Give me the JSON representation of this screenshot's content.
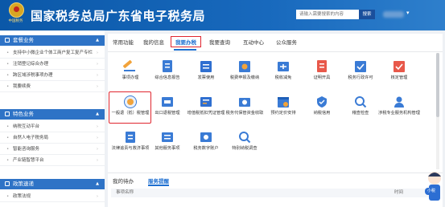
{
  "header": {
    "emblem_caption": "中国税务",
    "site_title": "国家税务总局广东省电子税务局",
    "search_placeholder": "请输入需要搜索的内容",
    "search_button": "搜索"
  },
  "sidebar": {
    "sections": [
      {
        "title": "套餐业务",
        "items": [
          "支持中小微企业个体工商户复工复产专栏",
          "注销登记综合办理",
          "跨区域涉税事项办理",
          "我要续费"
        ]
      },
      {
        "title": "特色业务",
        "items": [
          "纳税互动平台",
          "自然人电子税务局",
          "智能咨询服务",
          "产业链智慧平台"
        ]
      },
      {
        "title": "政策速递",
        "items": [
          "政策法规"
        ]
      }
    ]
  },
  "main": {
    "tabs": [
      "常用功能",
      "我的信息",
      "我要办税",
      "我要查询",
      "互动中心",
      "公众服务"
    ],
    "active_tab": "我要办税",
    "tiles": [
      {
        "label": "事项办理",
        "icon": "pen-icon"
      },
      {
        "label": "综合信息报告",
        "icon": "info-report-icon"
      },
      {
        "label": "发票使用",
        "icon": "invoice-icon"
      },
      {
        "label": "税费申报及缴纳",
        "icon": "tax-declare-icon"
      },
      {
        "label": "税收减免",
        "icon": "tax-relief-icon"
      },
      {
        "label": "证明开具",
        "icon": "certificate-icon"
      },
      {
        "label": "税务行政许可",
        "icon": "license-icon"
      },
      {
        "label": "核定管理",
        "icon": "verify-icon"
      },
      {
        "label": "一般退（抵）税管理",
        "icon": "refund-icon"
      },
      {
        "label": "出口退税管理",
        "icon": "export-refund-icon"
      },
      {
        "label": "增值税抵扣凭证管理",
        "icon": "vat-deduction-icon"
      },
      {
        "label": "税务代保管资金收取",
        "icon": "fund-custody-icon"
      },
      {
        "label": "预约定价安排",
        "icon": "calendar-icon"
      },
      {
        "label": "纳税信用",
        "icon": "credit-icon"
      },
      {
        "label": "稽查检查",
        "icon": "inspection-icon"
      },
      {
        "label": "涉税专业服务机构管理",
        "icon": "agency-icon"
      },
      {
        "label": "法律追责与救济事项",
        "icon": "law-icon"
      },
      {
        "label": "其他服务事项",
        "icon": "other-services-icon"
      },
      {
        "label": "税务数字账户",
        "icon": "digital-account-icon"
      },
      {
        "label": "特别纳税调查",
        "icon": "special-tax-icon"
      }
    ],
    "bottom_tabs": [
      "我的待办",
      "服务提醒"
    ],
    "table_headers": [
      "事项名称",
      "时间"
    ]
  },
  "mascot": {
    "bubble_text": "小税"
  },
  "colors": {
    "header_blue": "#0b58a8",
    "sidebar_section": "#2e73c6",
    "highlight_red": "#e0262f",
    "link_blue": "#1e6fd0"
  }
}
